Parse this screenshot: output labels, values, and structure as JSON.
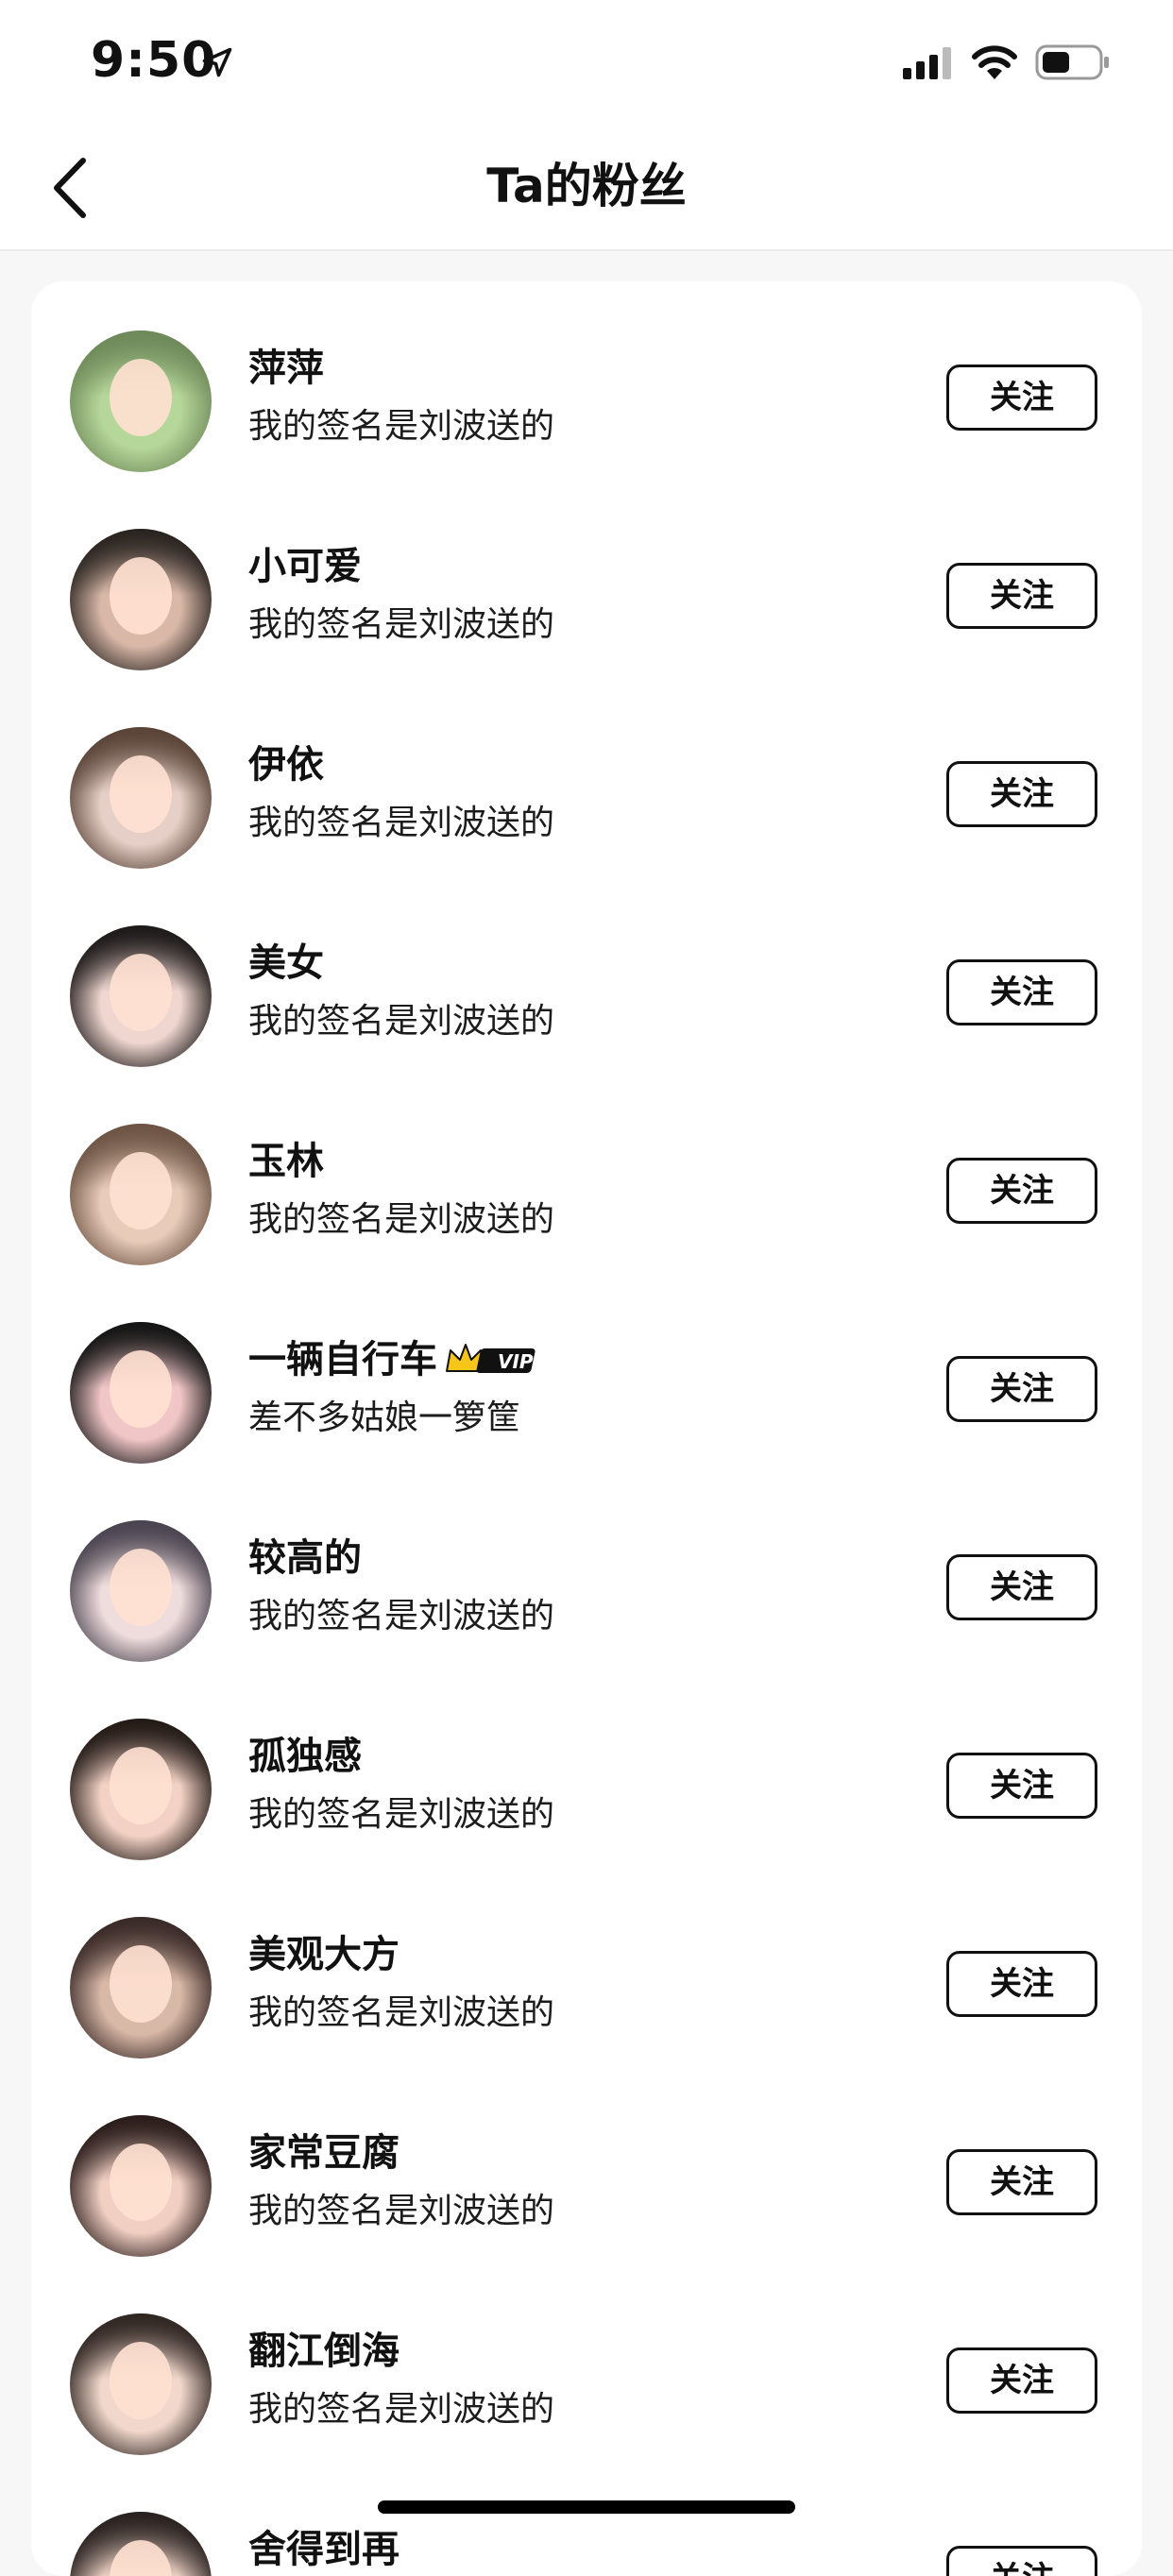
{
  "status_bar": {
    "time": "9:50",
    "icons": [
      "location-arrow-icon",
      "signal-icon",
      "wifi-icon",
      "battery-icon"
    ]
  },
  "nav": {
    "title": "Ta的粉丝",
    "back_icon": "chevron-left-icon"
  },
  "fans": [
    {
      "name": "萍萍",
      "signature": "我的签名是刘波送的",
      "button": "关注",
      "vip": false,
      "avatar_colors": [
        "#6f8a5a",
        "#b6d79a"
      ]
    },
    {
      "name": "小可爱",
      "signature": "我的签名是刘波送的",
      "button": "关注",
      "vip": false,
      "avatar_colors": [
        "#2a2420",
        "#d9b8a8"
      ]
    },
    {
      "name": "伊依",
      "signature": "我的签名是刘波送的",
      "button": "关注",
      "vip": false,
      "avatar_colors": [
        "#5a4438",
        "#e6cfc6"
      ]
    },
    {
      "name": "美女",
      "signature": "我的签名是刘波送的",
      "button": "关注",
      "vip": false,
      "avatar_colors": [
        "#1e1a1a",
        "#efd6cf"
      ]
    },
    {
      "name": "玉林",
      "signature": "我的签名是刘波送的",
      "button": "关注",
      "vip": false,
      "avatar_colors": [
        "#6d5444",
        "#e8cbb9"
      ]
    },
    {
      "name": "一辆自行车",
      "signature": "差不多姑娘一箩筐",
      "button": "关注",
      "vip": true,
      "avatar_colors": [
        "#151515",
        "#f1c6c6"
      ]
    },
    {
      "name": "较高的",
      "signature": "我的签名是刘波送的",
      "button": "关注",
      "vip": false,
      "avatar_colors": [
        "#4a4450",
        "#efdcdc"
      ]
    },
    {
      "name": "孤独感",
      "signature": "我的签名是刘波送的",
      "button": "关注",
      "vip": false,
      "avatar_colors": [
        "#231a16",
        "#f3d2c5"
      ]
    },
    {
      "name": "美观大方",
      "signature": "我的签名是刘波送的",
      "button": "关注",
      "vip": false,
      "avatar_colors": [
        "#3a2a28",
        "#d8b8a6"
      ]
    },
    {
      "name": "家常豆腐",
      "signature": "我的签名是刘波送的",
      "button": "关注",
      "vip": false,
      "avatar_colors": [
        "#2b1d1b",
        "#f1cfc3"
      ]
    },
    {
      "name": "翻江倒海",
      "signature": "我的签名是刘波送的",
      "button": "关注",
      "vip": false,
      "avatar_colors": [
        "#302622",
        "#f2d8cc"
      ]
    },
    {
      "name": "舍得到再",
      "signature": "",
      "button": "关注",
      "vip": false,
      "avatar_colors": [
        "#2a2220",
        "#eed2c6"
      ]
    }
  ],
  "vip_label": "VIP"
}
